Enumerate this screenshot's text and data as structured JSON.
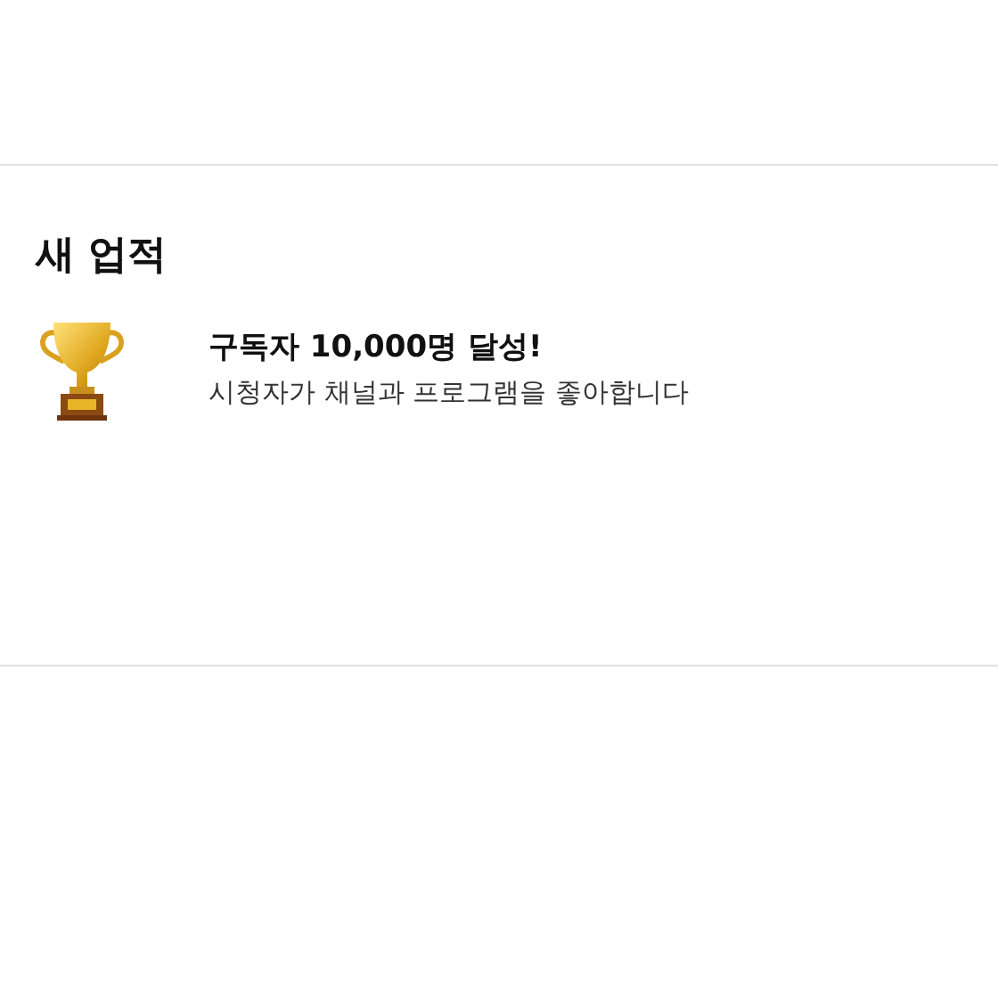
{
  "section": {
    "title": "새 업적"
  },
  "achievements": [
    {
      "title": "구독자 10,000명 달성!",
      "description": "시청자가 채널과 프로그램을 좋아합니다"
    }
  ]
}
